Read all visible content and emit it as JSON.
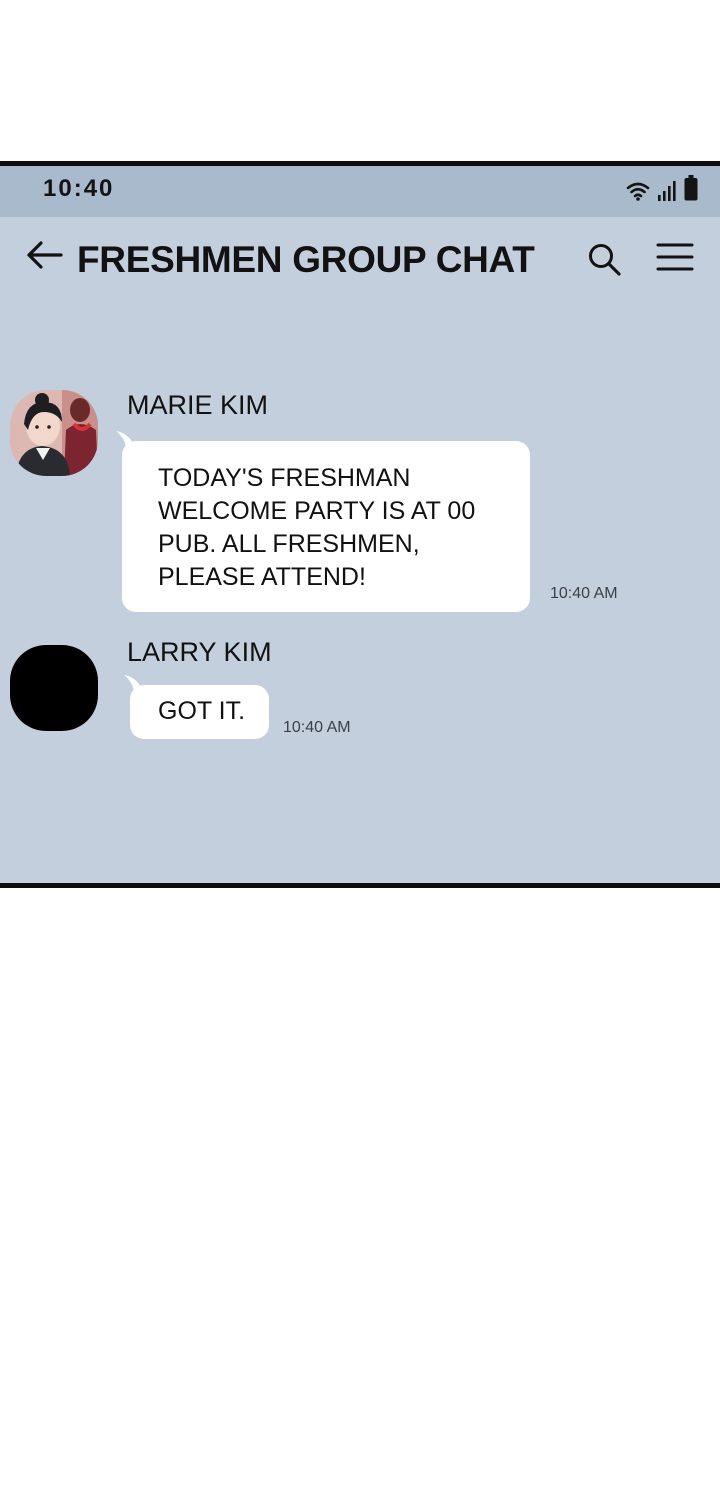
{
  "status_bar": {
    "time": "10:40",
    "icons": [
      "wifi-icon",
      "signal-icon",
      "battery-icon"
    ]
  },
  "header": {
    "title": "FRESHMEN GROUP CHAT",
    "icons": [
      "back-arrow-icon",
      "search-icon",
      "menu-icon"
    ]
  },
  "messages": [
    {
      "sender": "MARIE KIM",
      "text": "TODAY'S FRESHMAN WELCOME PARTY IS AT 00 PUB. ALL FRESHMEN, PLEASE ATTEND!",
      "time": "10:40 AM"
    },
    {
      "sender": "LARRY KIM",
      "text": "GOT IT.",
      "time": "10:40 AM"
    }
  ],
  "colors": {
    "chat_background": "#c3cfdd",
    "status_bar": "#a9bacd",
    "bubble": "#ffffff",
    "panel_border": "#0d0d0d"
  }
}
